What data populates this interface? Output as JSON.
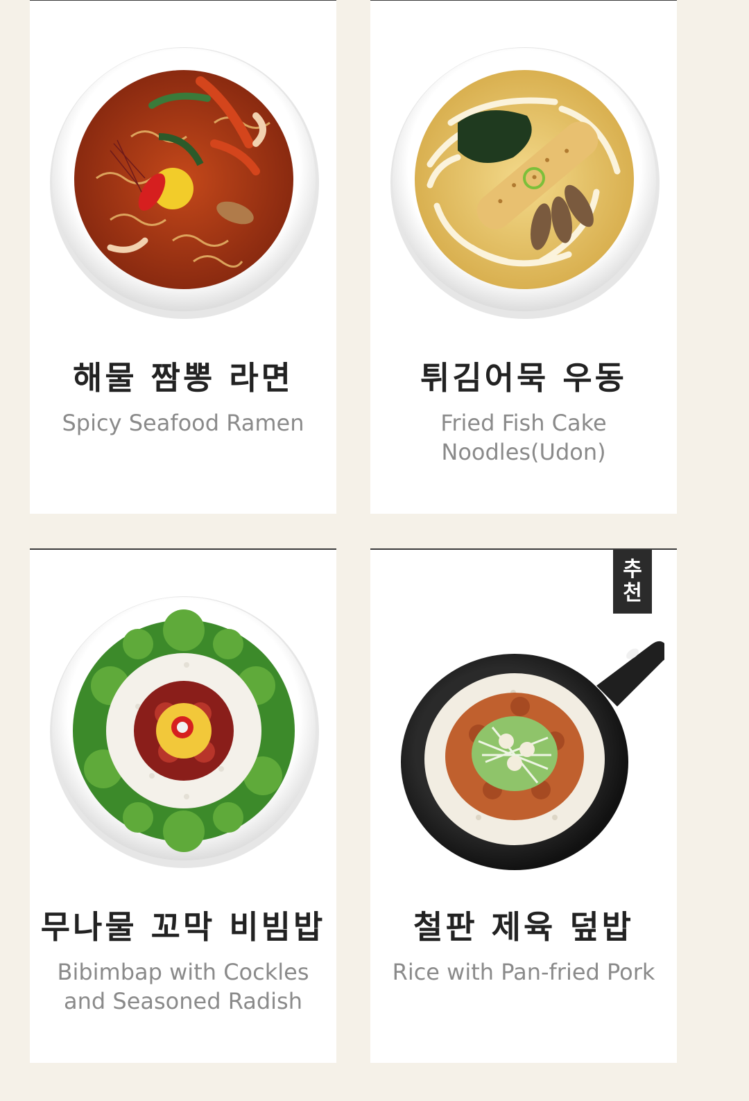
{
  "menu": {
    "items": [
      {
        "name_ko": "해물 짬뽕 라면",
        "name_en": "Spicy Seafood Ramen",
        "image": "spicy-seafood-ramen-photo",
        "badge": ""
      },
      {
        "name_ko": "튀김어묵 우동",
        "name_en": "Fried Fish Cake\nNoodles(Udon)",
        "image": "fried-fish-cake-udon-photo",
        "badge": ""
      },
      {
        "name_ko": "무나물 꼬막 비빔밥",
        "name_en": "Bibimbap with Cockles\nand Seasoned Radish",
        "image": "cockle-bibimbap-photo",
        "badge": ""
      },
      {
        "name_ko": "철판 제육 덮밥",
        "name_en": "Rice with Pan-fried Pork",
        "image": "pan-fried-pork-rice-photo",
        "badge": "추\n천"
      }
    ]
  },
  "colors": {
    "background": "#f5f1e8",
    "card": "#ffffff",
    "card_top_border": "#3a3a3a",
    "title_ko": "#222222",
    "title_en": "#8a8a8a",
    "badge_bg": "#2b2b2b"
  }
}
